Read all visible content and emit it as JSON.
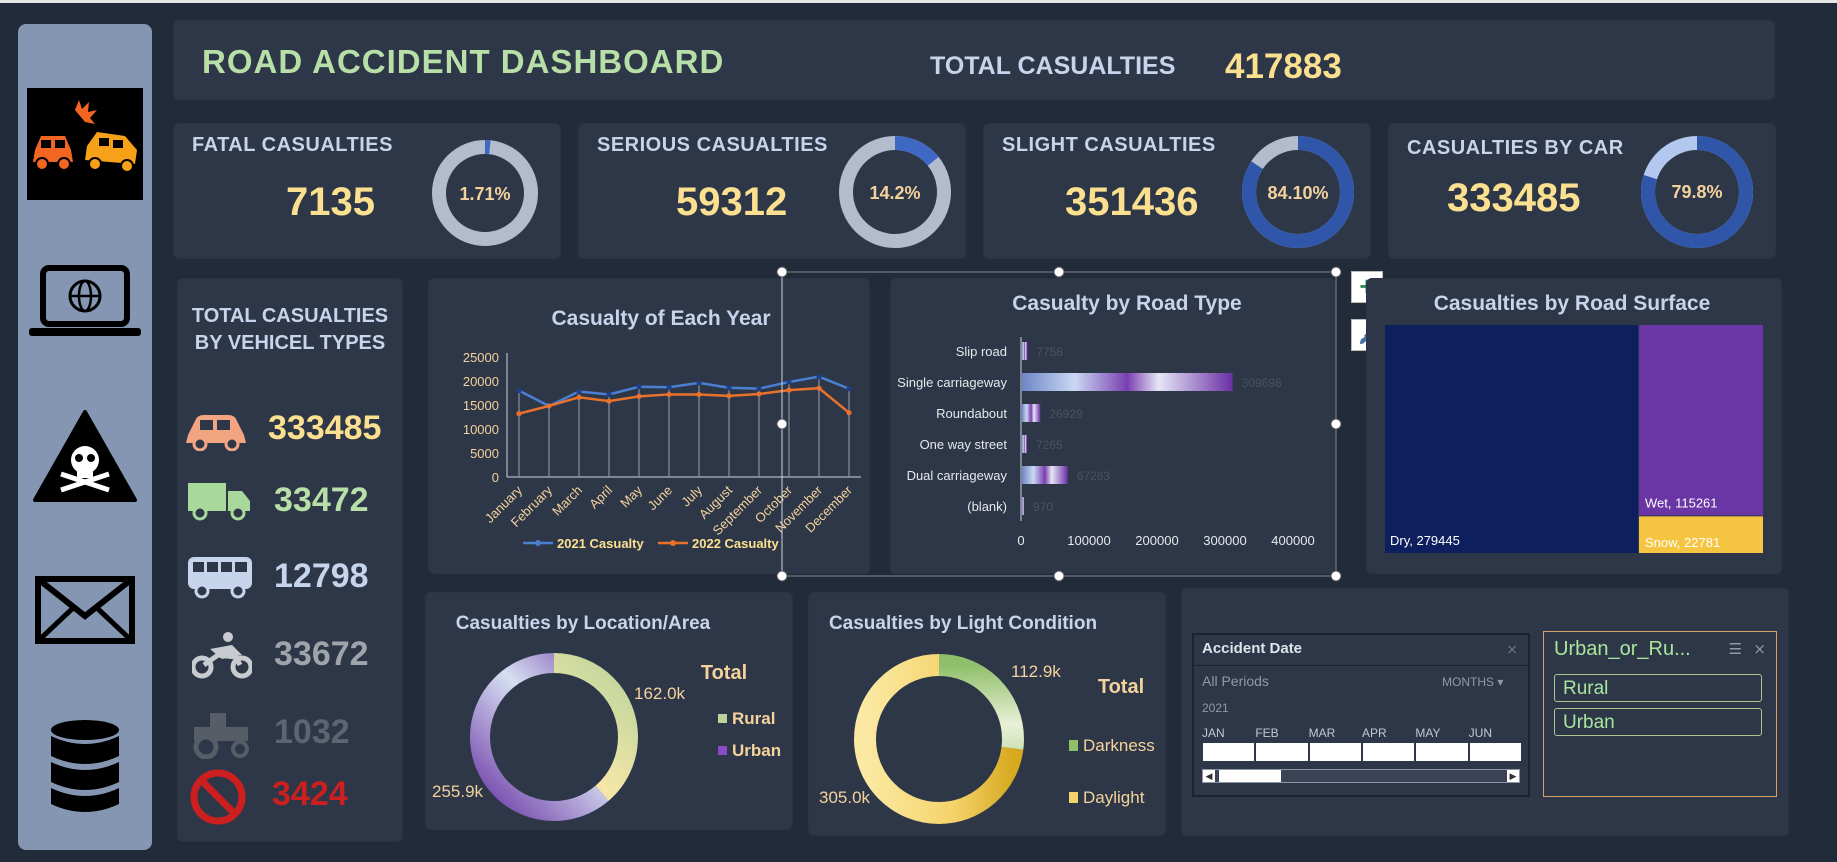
{
  "header": {
    "title": "ROAD ACCIDENT DASHBOARD",
    "total_label": "TOTAL CASUALTIES",
    "total_value": "417883"
  },
  "kpis": [
    {
      "title": "FATAL CASUALTIES",
      "value": "7135",
      "pct_label": "1.71%",
      "pct": 1.71
    },
    {
      "title": "SERIOUS CASUALTIES",
      "value": "59312",
      "pct_label": "14.2%",
      "pct": 14.2
    },
    {
      "title": "SLIGHT CASUALTIES",
      "value": "351436",
      "pct_label": "84.10%",
      "pct": 84.1
    },
    {
      "title": "CASUALTIES BY CAR",
      "value": "333485",
      "pct_label": "79.8%",
      "pct": 79.8
    }
  ],
  "sidebar": {
    "icons": [
      "car-crash-icon",
      "laptop-globe-icon",
      "hazard-skull-icon",
      "envelope-icon",
      "database-icon"
    ]
  },
  "vehicles": {
    "title_line1": "TOTAL CASUALTIES",
    "title_line2": "BY VEHICEL TYPES",
    "items": [
      {
        "icon": "car-icon",
        "value": "333485",
        "color": "#fbe08f"
      },
      {
        "icon": "truck-icon",
        "value": "33472",
        "color": "#b8dfa8"
      },
      {
        "icon": "bus-icon",
        "value": "12798",
        "color": "#c6d5ec"
      },
      {
        "icon": "motorbike-icon",
        "value": "33672",
        "color": "#a0a4aa"
      },
      {
        "icon": "tractor-icon",
        "value": "1032",
        "color": "#5e6470"
      },
      {
        "icon": "no-entry-icon",
        "value": "3424",
        "color": "#cc1f1f"
      }
    ]
  },
  "chart_data": [
    {
      "type": "line",
      "title": "Casualty of Each Year",
      "categories": [
        "January",
        "February",
        "March",
        "April",
        "May",
        "June",
        "July",
        "August",
        "September",
        "October",
        "November",
        "December"
      ],
      "ylim": [
        0,
        25000
      ],
      "yticks": [
        "0",
        "5000",
        "10000",
        "15000",
        "20000",
        "25000"
      ],
      "series": [
        {
          "name": "2021 Casualty",
          "color": "#4a7fd1",
          "values": [
            18000,
            14800,
            17800,
            17200,
            18800,
            18700,
            19600,
            18600,
            18400,
            19800,
            20900,
            18400
          ]
        },
        {
          "name": "2022 Casualty",
          "color": "#e8722c",
          "values": [
            13200,
            14800,
            16600,
            15800,
            16800,
            17200,
            17200,
            16900,
            17300,
            18100,
            18500,
            13400
          ]
        }
      ]
    },
    {
      "type": "bar",
      "title": "Casualty by Road Type",
      "categories": [
        "Slip road",
        "Single carriageway",
        "Roundabout",
        "One way street",
        "Dual carriageway",
        "(blank)"
      ],
      "values": [
        7758,
        309698,
        26929,
        7265,
        67263,
        970
      ],
      "value_labels": [
        "7758",
        "309698",
        "26929",
        "7265",
        "67263",
        "970"
      ],
      "xlim": [
        0,
        400000
      ],
      "xticks": [
        "0",
        "100000",
        "200000",
        "300000",
        "400000"
      ]
    },
    {
      "type": "heatmap",
      "title": "Casualties by Road Surface",
      "items": [
        {
          "label": "Dry, 279445",
          "value": 279445,
          "color": "#0d1f5c"
        },
        {
          "label": "Wet, 115261",
          "value": 115261,
          "color": "#6a35a4"
        },
        {
          "label": "Snow, 22781",
          "value": 22781,
          "color": "#f5c542"
        }
      ]
    },
    {
      "type": "pie",
      "title": "Casualties by Location/Area",
      "legend_title": "Total",
      "slices": [
        {
          "name": "Rural",
          "value": 162.0,
          "label": "162.0k",
          "color": "#b9d49b"
        },
        {
          "name": "Urban",
          "value": 255.9,
          "label": "255.9k",
          "color": "#6a35a4"
        }
      ]
    },
    {
      "type": "pie",
      "title": "Casualties by Light Condition",
      "legend_title": "Total",
      "slices": [
        {
          "name": "Darkness",
          "value": 112.9,
          "label": "112.9k",
          "color": "#8fbf6a"
        },
        {
          "name": "Daylight",
          "value": 305.0,
          "label": "305.0k",
          "color": "#f5d36b"
        }
      ]
    }
  ],
  "slicer": {
    "title": "Accident Date",
    "periods_label": "All Periods",
    "unit_label": "MONTHS",
    "year": "2021",
    "months": [
      "JAN",
      "FEB",
      "MAR",
      "APR",
      "MAY",
      "JUN"
    ]
  },
  "filter": {
    "title": "Urban_or_Ru...",
    "options": [
      "Rural",
      "Urban"
    ]
  },
  "chart_tools": {
    "add_label": "+"
  }
}
